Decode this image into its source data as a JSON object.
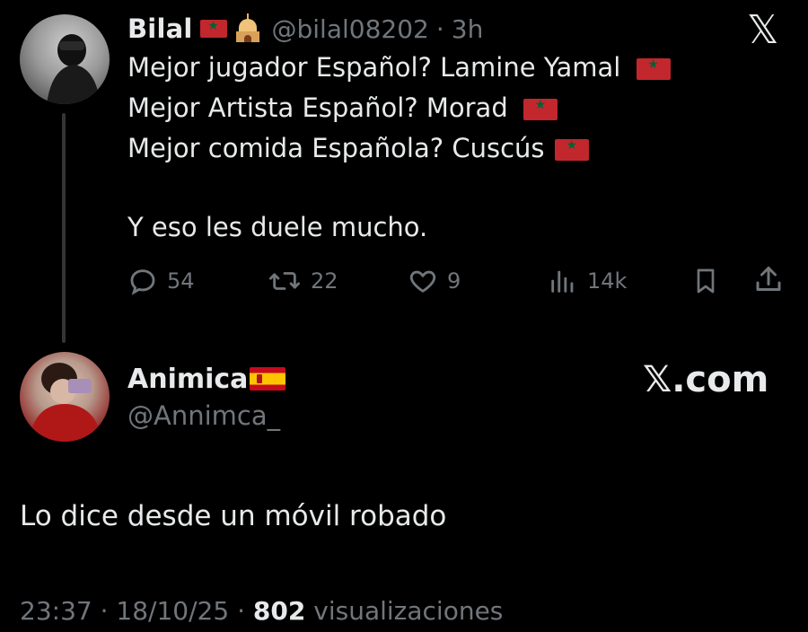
{
  "tweet": {
    "author_name": "Bilal",
    "handle": "@bilal08202",
    "separator": "·",
    "time_ago": "3h",
    "lines": [
      "Mejor jugador Español? Lamine Yamal",
      "Mejor Artista Español? Morad",
      "Mejor comida Española? Cuscús",
      "Y eso les duele mucho."
    ],
    "metrics": {
      "replies": "54",
      "reposts": "22",
      "likes": "9",
      "views": "14k"
    }
  },
  "reply": {
    "author_name": "Animica",
    "handle": "@Annimca_",
    "text": "Lo dice desde un móvil robado"
  },
  "branding": {
    "x_logo": "𝕏",
    "xcom_label": "𝕏.com"
  },
  "footer": {
    "time": "23:37",
    "dot": "·",
    "date": "18/10/25",
    "views_count": "802",
    "views_label": "visualizaciones"
  },
  "icons": {
    "reply": "reply-icon",
    "repost": "repost-icon",
    "like": "heart-icon",
    "views": "views-icon",
    "bookmark": "bookmark-icon",
    "share": "share-icon"
  },
  "colors": {
    "background": "#000000",
    "primary_text": "#e7e9ea",
    "secondary_text": "#71767b",
    "thread_line": "#333639"
  }
}
